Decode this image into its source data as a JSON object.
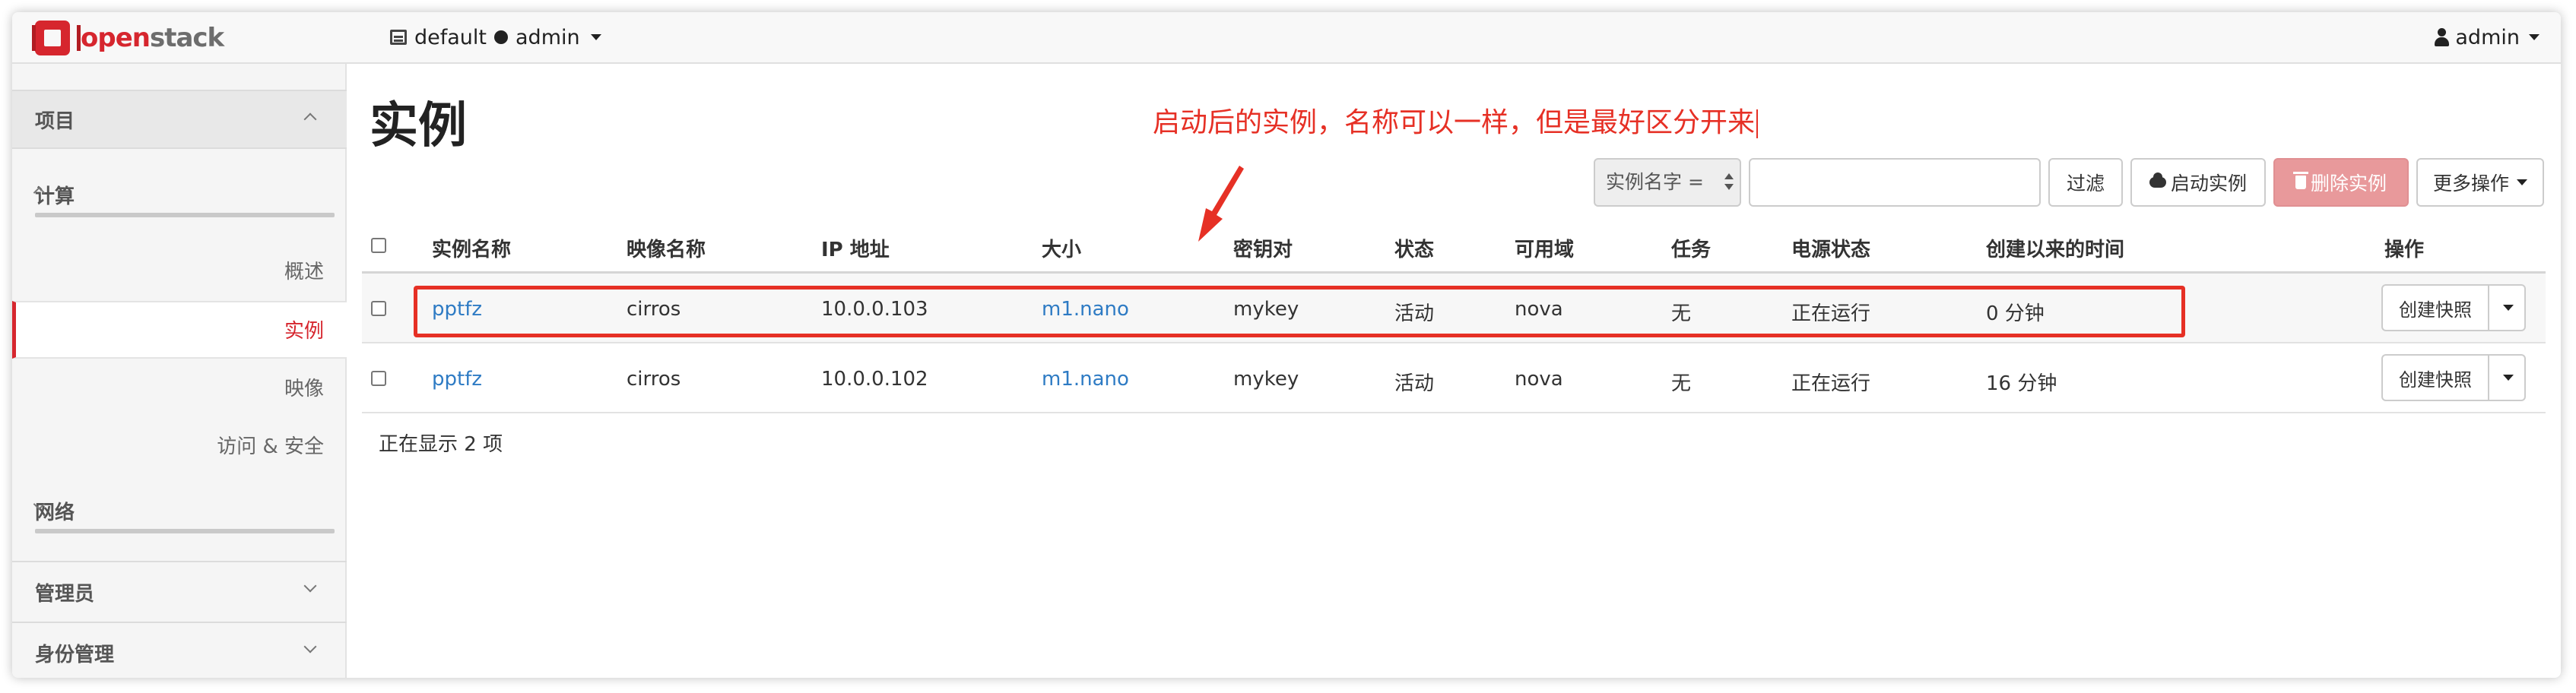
{
  "navbar": {
    "brand_open": "open",
    "brand_stack": "stack",
    "domain": "default",
    "project": "admin",
    "user": "admin"
  },
  "sidebar": {
    "project_label": "项目",
    "compute_label": "计算",
    "items": [
      {
        "label": "概述",
        "active": false
      },
      {
        "label": "实例",
        "active": true
      },
      {
        "label": "映像",
        "active": false
      },
      {
        "label": "访问 & 安全",
        "active": false
      }
    ],
    "network_label": "网络",
    "admin_label": "管理员",
    "identity_label": "身份管理"
  },
  "page": {
    "title": "实例",
    "annotation": "启动后的实例，名称可以一样，但是最好区分开来"
  },
  "toolbar": {
    "filter_select": "实例名字 =",
    "filter_input_value": "",
    "filter_button": "过滤",
    "launch_button": "启动实例",
    "delete_button": "删除实例",
    "more_button": "更多操作"
  },
  "table": {
    "headers": [
      "实例名称",
      "映像名称",
      "IP 地址",
      "大小",
      "密钥对",
      "状态",
      "可用域",
      "任务",
      "电源状态",
      "创建以来的时间",
      "操作"
    ],
    "rows": [
      {
        "name": "pptfz",
        "image": "cirros",
        "ip": "10.0.0.103",
        "size": "m1.nano",
        "keypair": "mykey",
        "status": "活动",
        "zone": "nova",
        "task": "无",
        "power": "正在运行",
        "age": "0 分钟",
        "action": "创建快照"
      },
      {
        "name": "pptfz",
        "image": "cirros",
        "ip": "10.0.0.102",
        "size": "m1.nano",
        "keypair": "mykey",
        "status": "活动",
        "zone": "nova",
        "task": "无",
        "power": "正在运行",
        "age": "16 分钟",
        "action": "创建快照"
      }
    ],
    "footer": "正在显示 2 项"
  },
  "colors": {
    "brand": "#d6262e",
    "link": "#2e7bc4",
    "annotation": "#e63025",
    "delete_button": "#e8999b"
  }
}
